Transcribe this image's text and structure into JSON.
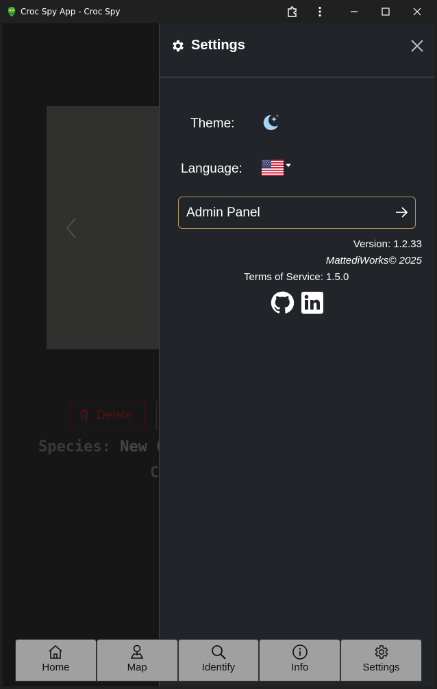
{
  "window": {
    "title": "Croc Spy App - Croc Spy"
  },
  "background_page": {
    "delete_label": "Delete",
    "species_label": "Species:",
    "species_value": "New G",
    "species_line2": "C"
  },
  "settings": {
    "title": "Settings",
    "theme_label": "Theme:",
    "theme_icon": "moon-stars-icon",
    "language_label": "Language:",
    "language_flag": "us-flag",
    "admin_panel_label": "Admin Panel",
    "version_text": "Version: 1.2.33",
    "credit_text": "MattediWorks© 2025",
    "tos_text": "Terms of Service: 1.5.0",
    "links": [
      "github-icon",
      "linkedin-icon"
    ]
  },
  "nav": {
    "items": [
      {
        "label": "Home",
        "icon": "home-icon"
      },
      {
        "label": "Map",
        "icon": "map-pin-icon"
      },
      {
        "label": "Identify",
        "icon": "search-icon"
      },
      {
        "label": "Info",
        "icon": "info-icon"
      },
      {
        "label": "Settings",
        "icon": "gear-icon"
      }
    ]
  },
  "colors": {
    "panel_bg": "#212529",
    "admin_border": "#b49a5e",
    "nav_bg": "#a0a0a0",
    "delete_red": "#7a2020"
  }
}
